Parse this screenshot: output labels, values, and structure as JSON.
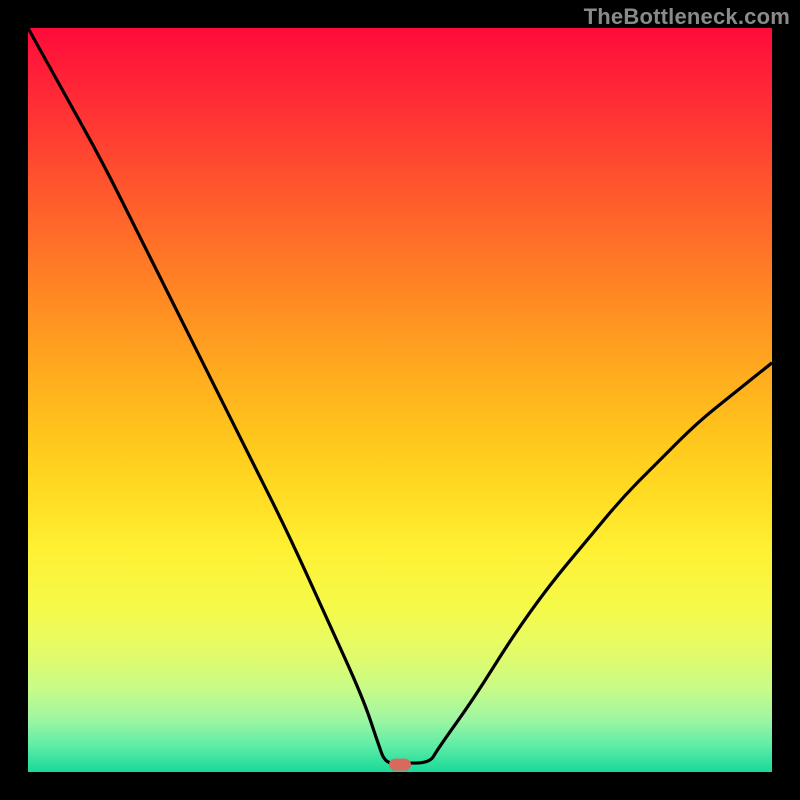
{
  "watermark": "TheBottleneck.com",
  "chart_data": {
    "type": "line",
    "title": "",
    "xlabel": "",
    "ylabel": "",
    "xlim": [
      0,
      100
    ],
    "ylim": [
      0,
      100
    ],
    "grid": false,
    "legend": false,
    "series": [
      {
        "name": "bottleneck-curve",
        "x": [
          0,
          5,
          10,
          15,
          20,
          25,
          30,
          35,
          40,
          45,
          47,
          48,
          50,
          54,
          55,
          60,
          65,
          70,
          75,
          80,
          85,
          90,
          95,
          100
        ],
        "values": [
          100,
          91,
          82,
          72,
          62,
          52,
          42,
          32,
          21,
          10,
          4,
          1.2,
          1.2,
          1.2,
          3,
          10,
          18,
          25,
          31,
          37,
          42,
          47,
          51,
          55
        ]
      }
    ],
    "annotations": [
      {
        "name": "optimal-marker",
        "x": 50,
        "y": 1.0,
        "shape": "pill",
        "color": "#d86a5d"
      }
    ],
    "colors": {
      "gradient_top": "#ff0a3a",
      "gradient_bottom": "#17d99a",
      "curve": "#000000",
      "marker": "#d86a5d",
      "frame": "#000000"
    }
  }
}
